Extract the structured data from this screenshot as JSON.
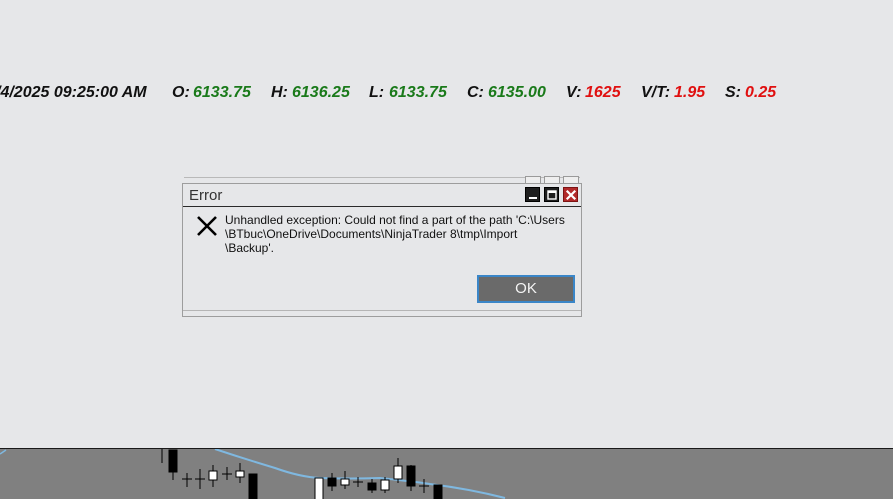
{
  "quote_bar": {
    "datetime": "/4/2025 09:25:00 AM",
    "open_label": "O:",
    "open_value": "6133.75",
    "high_label": "H:",
    "high_value": "6136.25",
    "low_label": "L:",
    "low_value": "6133.75",
    "close_label": "C:",
    "close_value": "6135.00",
    "volume_label": "V:",
    "volume_value": "1625",
    "vt_label": "V/T:",
    "vt_value": "1.95",
    "spread_label": "S:",
    "spread_value": "0.25"
  },
  "dialog": {
    "title": "Error",
    "message": "Unhandled exception: Could not find a part of the path 'C:\\Users\n\\BTbuc\\OneDrive\\Documents\\NinjaTrader 8\\tmp\\Import\n\\Backup'.",
    "ok_label": "OK"
  },
  "icons": [
    "error-x-icon",
    "minimize-icon",
    "maximize-icon",
    "close-icon"
  ],
  "colors": {
    "background": "#e6e7e9",
    "up_value": "#1a7a1a",
    "down_value": "#e01010",
    "close_button": "#b22a2a",
    "ok_button": "#6a6a6a",
    "ok_focus_border": "#3a86c8",
    "chart_panel": "#808080",
    "moving_average": "#7fb8e0"
  }
}
